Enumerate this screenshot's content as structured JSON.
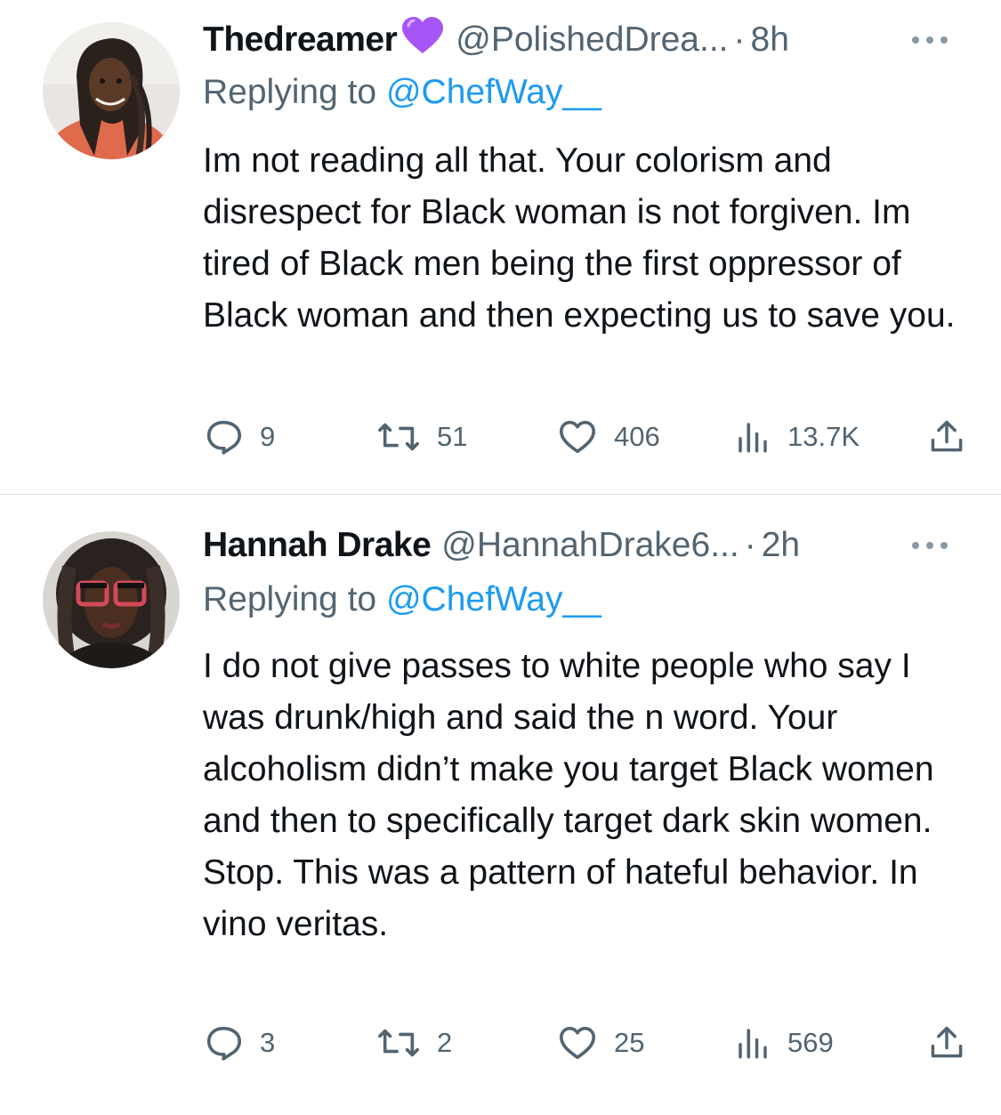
{
  "tweets": [
    {
      "display_name": "Thedreamer",
      "badge": "purple-heart-emoji",
      "handle": "@PolishedDrea...",
      "time": "8h",
      "replying_label": "Replying to",
      "replying_handle": "@ChefWay__",
      "text": "Im not reading all that. Your colorism and disrespect for Black woman is not forgiven. Im tired of Black men being the first oppressor of Black woman and then expecting us to save you.",
      "replies": "9",
      "retweets": "51",
      "likes": "406",
      "views": "13.7K"
    },
    {
      "display_name": "Hannah Drake",
      "handle": "@HannahDrake6...",
      "time": "2h",
      "replying_label": "Replying to",
      "replying_handle": "@ChefWay__",
      "text": "I do not give passes to white people who say I was drunk/high and said the n word. Your alcoholism didn’t make you target Black women and then to specifically target dark skin women. Stop. This was a pattern of hateful behavior. In vino veritas.",
      "replies": "3",
      "retweets": "2",
      "likes": "25",
      "views": "569"
    }
  ],
  "colors": {
    "text_primary": "#0f1419",
    "text_secondary": "#536471",
    "link": "#1d9bf0",
    "divider": "#dcdfe2",
    "heart_emoji": "#a855f7"
  },
  "icons": [
    "reply-icon",
    "retweet-icon",
    "like-icon",
    "views-icon",
    "share-icon",
    "more-icon"
  ]
}
